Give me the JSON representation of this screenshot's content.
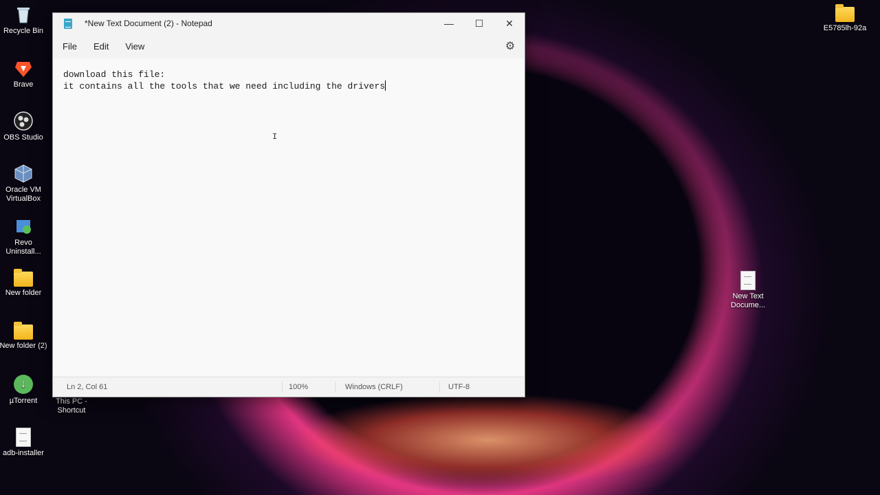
{
  "desktop": {
    "left_icons": [
      {
        "label": "Recycle Bin",
        "icon": "recycle-bin-icon"
      },
      {
        "label": "Brave",
        "icon": "brave-icon"
      },
      {
        "label": "OBS Studio",
        "icon": "obs-icon"
      },
      {
        "label": "Oracle VM VirtualBox",
        "icon": "virtualbox-icon"
      },
      {
        "label": "Revo Uninstall...",
        "icon": "revo-uninstaller-icon"
      },
      {
        "label": "New folder",
        "icon": "folder-icon"
      },
      {
        "label": "New folder (2)",
        "icon": "folder-icon"
      },
      {
        "label": "µTorrent",
        "icon": "utorrent-icon"
      },
      {
        "label": "adb-installer",
        "icon": "text-file-icon"
      }
    ],
    "shortcut_label": "This PC - Shortcut",
    "right_icons": [
      {
        "label": "E5785lh-92a",
        "icon": "folder-icon"
      },
      {
        "label": "New Text Docume...",
        "icon": "text-file-icon"
      }
    ]
  },
  "notepad": {
    "title": "*New Text Document (2) - Notepad",
    "controls": {
      "minimize": "—",
      "maximize": "☐",
      "close": "✕"
    },
    "menu": [
      "File",
      "Edit",
      "View"
    ],
    "settings_icon": "gear-icon",
    "lines": [
      "download this file:",
      "it contains all the tools that we need including the drivers"
    ],
    "status": {
      "position": "Ln 2, Col 61",
      "zoom": "100%",
      "line_ending": "Windows (CRLF)",
      "encoding": "UTF-8"
    }
  }
}
